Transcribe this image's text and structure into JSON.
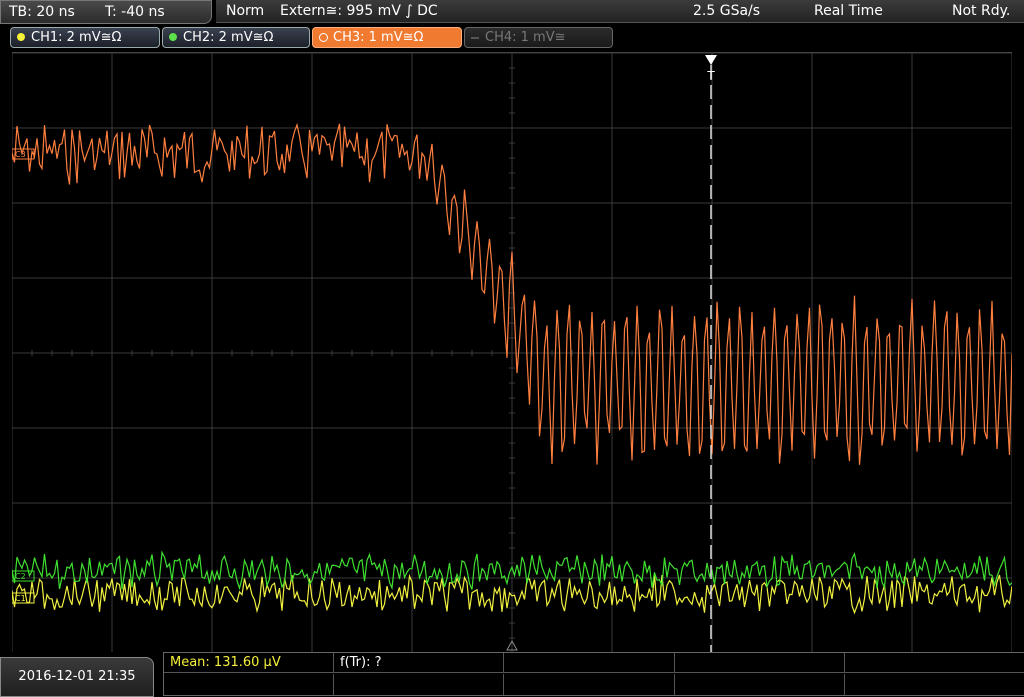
{
  "top": {
    "timebase": "TB: 20 ns",
    "trigger_offset": "T: -40 ns",
    "trigger_mode": "Norm",
    "trigger_source": "Extern≅: 995 mV ∫ DC",
    "sample_rate": "2.5 GSa/s",
    "acq_mode": "Real Time",
    "state": "Not Rdy."
  },
  "channels": [
    {
      "label": "CH1: 2 mV≅Ω",
      "color": "#f5f03a"
    },
    {
      "label": "CH2: 2 mV≅Ω",
      "color": "#5ee04a"
    },
    {
      "label": "CH3: 1 mV≅Ω",
      "color": "#f07a30"
    },
    {
      "label": "CH4: 1 mV≅",
      "color": "#777777"
    }
  ],
  "markers": {
    "ch3": "C3",
    "ch2": "C2",
    "ch1": "C1",
    "trigger": "T"
  },
  "bottom": {
    "datetime": "2016-12-01 21:35",
    "mean": "Mean: 131.60 µV",
    "ftr": "f(Tr): ?"
  },
  "colors": {
    "ch3_trace": "#ff7f3f",
    "ch2_trace": "#3fe030",
    "ch1_trace": "#f0f040",
    "grid": "#3a3a3a"
  }
}
